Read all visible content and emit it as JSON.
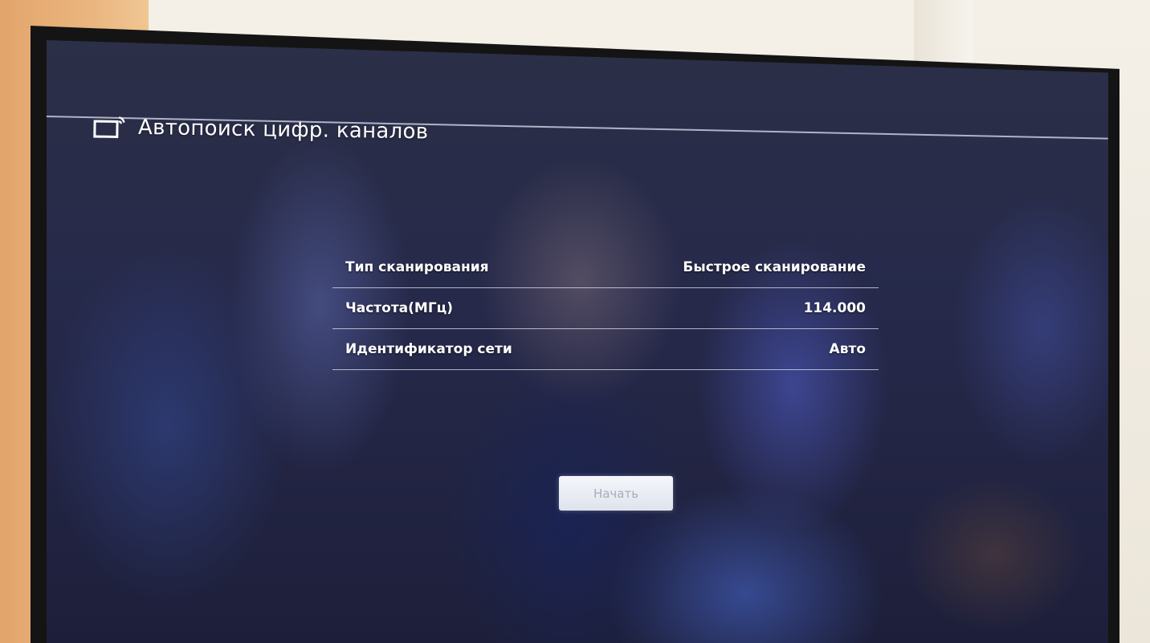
{
  "header": {
    "icon": "tv-signal-icon",
    "title": "Автопоиск цифр. каналов"
  },
  "settings": [
    {
      "label": "Тип сканирования",
      "value": "Быстрое сканирование"
    },
    {
      "label": "Частота(МГц)",
      "value": "114.000"
    },
    {
      "label": "Идентификатор сети",
      "value": "Авто"
    }
  ],
  "actions": {
    "start_label": "Начать"
  },
  "colors": {
    "text": "#ffffff",
    "divider": "#e6ebf5",
    "button_bg": "#eef1f7",
    "button_text": "#a8adb8"
  }
}
